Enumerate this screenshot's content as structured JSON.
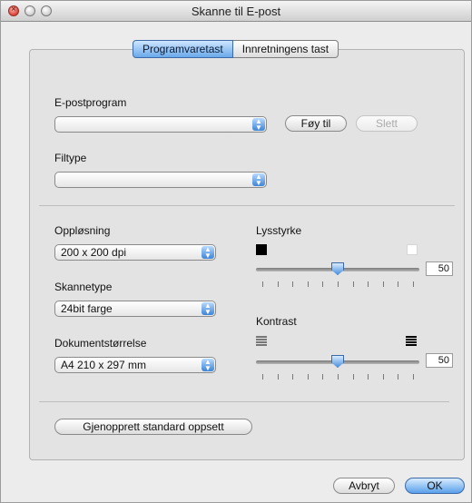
{
  "window": {
    "title": "Skanne til E-post"
  },
  "tabs": [
    {
      "label": "Programvaretast",
      "active": true
    },
    {
      "label": "Innretningens tast",
      "active": false
    }
  ],
  "email": {
    "label": "E-postprogram",
    "value": "",
    "add_button": "Føy til",
    "delete_button": "Slett"
  },
  "filetype": {
    "label": "Filtype",
    "value": ""
  },
  "resolution": {
    "label": "Oppløsning",
    "value": "200 x 200 dpi"
  },
  "scantype": {
    "label": "Skannetype",
    "value": "24bit farge"
  },
  "docsize": {
    "label": "Dokumentstørrelse",
    "value": "A4 210 x 297 mm"
  },
  "brightness": {
    "label": "Lysstyrke",
    "value": "50",
    "level": 0.5
  },
  "contrast": {
    "label": "Kontrast",
    "value": "50",
    "level": 0.5
  },
  "restore_button": "Gjenopprett standard oppsett",
  "footer": {
    "cancel": "Avbryt",
    "ok": "OK"
  },
  "colors": {
    "accent": "#5aa0ea"
  }
}
